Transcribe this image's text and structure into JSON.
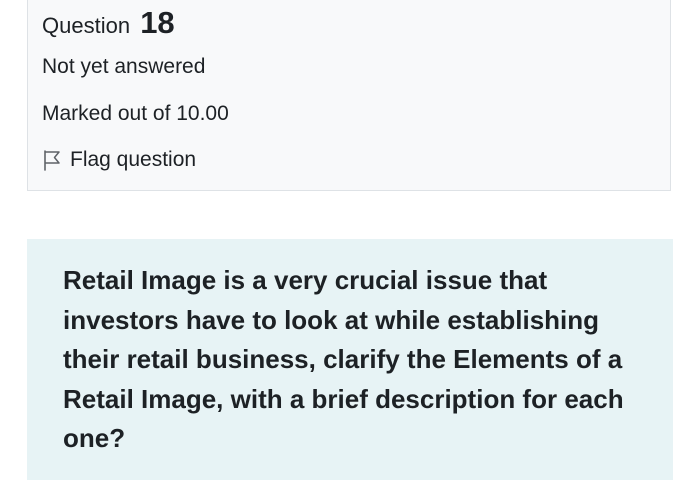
{
  "info": {
    "question_label": "Question",
    "question_number": "18",
    "state": "Not yet answered",
    "grade": "Marked out of 10.00",
    "flag_label": "Flag question",
    "flag_icon": "flag-outline-icon"
  },
  "question": {
    "text": "Retail Image is a very crucial issue that investors have to look at while establishing their retail business, clarify the Elements of a Retail Image, with a brief description for each one?"
  },
  "colors": {
    "info_bg": "#f8f9fa",
    "info_border": "#dee2e6",
    "question_bg": "#e7f3f5",
    "text": "#1d2125"
  }
}
